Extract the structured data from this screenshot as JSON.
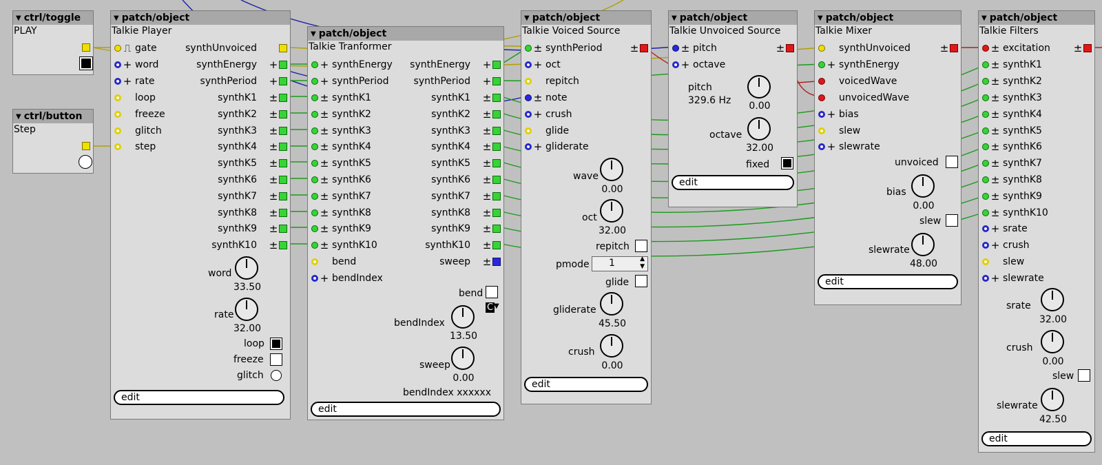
{
  "header_prefix": "▼",
  "objects": {
    "toggle": {
      "type": "ctrl/toggle",
      "instance": "PLAY"
    },
    "button": {
      "type": "ctrl/button",
      "instance": "Step"
    },
    "player": {
      "type": "patch/object",
      "instance": "Talkie Player",
      "inlets": [
        "gate",
        "word",
        "rate",
        "loop",
        "freeze",
        "glitch",
        "step"
      ],
      "outlets": [
        "synthUnvoiced",
        "synthEnergy",
        "synthPeriod",
        "synthK1",
        "synthK2",
        "synthK3",
        "synthK4",
        "synthK5",
        "synthK6",
        "synthK7",
        "synthK8",
        "synthK9",
        "synthK10"
      ],
      "word_label": "word",
      "word_value": "33.50",
      "rate_label": "rate",
      "rate_value": "32.00",
      "loop_label": "loop",
      "freeze_label": "freeze",
      "glitch_label": "glitch",
      "edit": "edit"
    },
    "transformer": {
      "type": "patch/object",
      "instance": "Talkie Tranformer",
      "inlets": [
        "synthEnergy",
        "synthPeriod",
        "synthK1",
        "synthK2",
        "synthK3",
        "synthK4",
        "synthK5",
        "synthK6",
        "synthK7",
        "synthK8",
        "synthK9",
        "synthK10",
        "bend",
        "bendIndex"
      ],
      "outlets": [
        "synthEnergy",
        "synthPeriod",
        "synthK1",
        "synthK2",
        "synthK3",
        "synthK4",
        "synthK5",
        "synthK6",
        "synthK7",
        "synthK8",
        "synthK9",
        "synthK10",
        "sweep"
      ],
      "bend_label": "bend",
      "bend_select": "C",
      "bendIndex_label": "bendIndex",
      "bendIndex_value": "13.50",
      "sweep_label": "sweep",
      "sweep_value": "0.00",
      "display_label": "bendIndex",
      "display_value": "xxxxxx",
      "edit": "edit"
    },
    "voiced": {
      "type": "patch/object",
      "instance": "Talkie Voiced Source",
      "inlets": [
        "synthPeriod",
        "oct",
        "repitch",
        "note",
        "crush",
        "glide",
        "gliderate"
      ],
      "wave_label": "wave",
      "wave_value": "0.00",
      "oct_label": "oct",
      "oct_value": "32.00",
      "repitch_label": "repitch",
      "pmode_label": "pmode",
      "pmode_value": "1",
      "glide_label": "glide",
      "gliderate_label": "gliderate",
      "gliderate_value": "45.50",
      "crush_label": "crush",
      "crush_value": "0.00",
      "edit": "edit"
    },
    "unvoiced": {
      "type": "patch/object",
      "instance": "Talkie Unvoiced Source",
      "inlets": [
        "pitch",
        "octave"
      ],
      "pitch_label": "pitch",
      "pitch_display": "329.6 Hz",
      "pitch_value": "0.00",
      "octave_label": "octave",
      "octave_value": "32.00",
      "fixed_label": "fixed",
      "edit": "edit"
    },
    "mixer": {
      "type": "patch/object",
      "instance": "Talkie Mixer",
      "inlets": [
        "synthUnvoiced",
        "synthEnergy",
        "voicedWave",
        "unvoicedWave",
        "bias",
        "slew",
        "slewrate"
      ],
      "unvoiced_label": "unvoiced",
      "bias_label": "bias",
      "bias_value": "0.00",
      "slew_label": "slew",
      "slewrate_label": "slewrate",
      "slewrate_value": "48.00",
      "edit": "edit"
    },
    "filters": {
      "type": "patch/object",
      "instance": "Talkie Filters",
      "inlets": [
        "excitation",
        "synthK1",
        "synthK2",
        "synthK3",
        "synthK4",
        "synthK5",
        "synthK6",
        "synthK7",
        "synthK8",
        "synthK9",
        "synthK10",
        "srate",
        "crush",
        "slew",
        "slewrate"
      ],
      "srate_label": "srate",
      "srate_value": "32.00",
      "crush_label": "crush",
      "crush_value": "0.00",
      "slew_label": "slew",
      "slewrate_label": "slewrate",
      "slewrate_value": "42.50",
      "edit": "edit"
    }
  },
  "colors": {
    "background": "#c0c0c0",
    "panel": "#dcdcdc",
    "header": "#a8a8a8",
    "wire_green": "#1a9a1a",
    "wire_blue": "#2020a8",
    "wire_yellow": "#b0a000",
    "wire_red": "#b02020",
    "port_green": "#36d436",
    "port_blue": "#2828c8",
    "port_yellow": "#eee000",
    "port_red": "#e01818"
  },
  "icons": [
    "triangle-down-icon",
    "pulse-icon",
    "plus-icon",
    "plusminus-icon",
    "port-icon",
    "knob-icon",
    "checkbox-icon",
    "radio-icon"
  ]
}
